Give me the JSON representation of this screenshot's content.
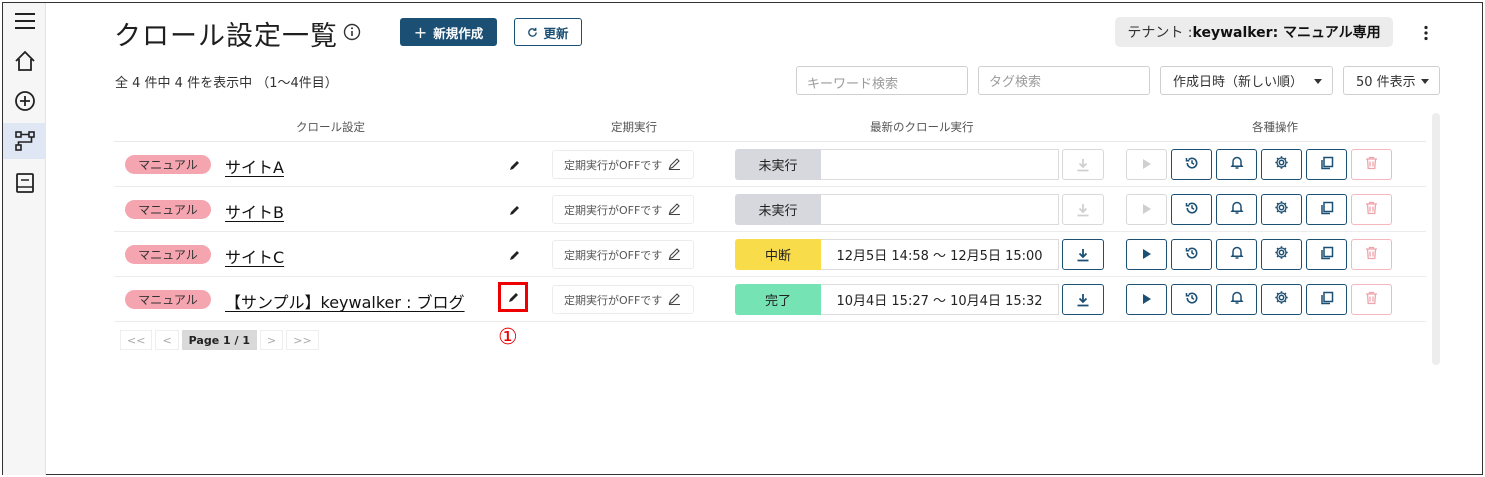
{
  "page": {
    "title": "クロール設定一覧",
    "new_button": "新規作成",
    "refresh_button": "更新",
    "tenant_prefix": "テナント : ",
    "tenant_name": "keywalker: マニュアル専用",
    "count_text": "全 4 件中 4 件を表示中 （1～4件目）",
    "keyword_placeholder": "キーワード検索",
    "tag_placeholder": "タグ検索",
    "sort_value": "作成日時（新しい順）",
    "perpage_value": "50 件表示"
  },
  "columns": {
    "crawl_setting": "クロール設定",
    "schedule": "定期実行",
    "latest_run": "最新のクロール実行",
    "operations": "各種操作"
  },
  "rows": [
    {
      "badge": "マニュアル",
      "name": "サイトA",
      "schedule": "定期実行がOFFです",
      "status": "未実行",
      "status_kind": "idle",
      "period": ""
    },
    {
      "badge": "マニュアル",
      "name": "サイトB",
      "schedule": "定期実行がOFFです",
      "status": "未実行",
      "status_kind": "idle",
      "period": ""
    },
    {
      "badge": "マニュアル",
      "name": "サイトC",
      "schedule": "定期実行がOFFです",
      "status": "中断",
      "status_kind": "abort",
      "period": "12月5日 14:58 ～ 12月5日 15:00"
    },
    {
      "badge": "マニュアル",
      "name": "【サンプル】keywalker : ブログ",
      "schedule": "定期実行がOFFです",
      "status": "完了",
      "status_kind": "done",
      "period": "10月4日 15:27 ～ 10月4日 15:32"
    }
  ],
  "pager": {
    "first": "<<",
    "prev": "<",
    "label": "Page",
    "current": "1 / 1",
    "next": ">",
    "last": ">>"
  },
  "annotation": {
    "marker": "①",
    "color": "#e00000"
  },
  "colors": {
    "primary": "#1b4f74",
    "badge": "#f4a5b0",
    "abort": "#f9dc4a",
    "done": "#75e3b4",
    "idle": "#d6d8dd"
  }
}
